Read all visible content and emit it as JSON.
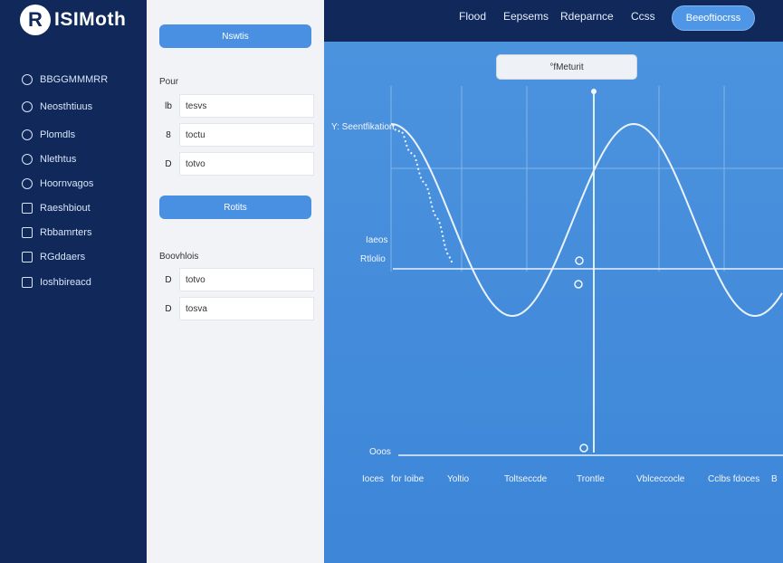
{
  "app": {
    "logo_mark": "R",
    "name": "ISIMoth"
  },
  "topnav": {
    "links": [
      "Flood",
      "Eepsems",
      "Rdeparnce",
      "Ccss"
    ],
    "action_button": "Beeoftiocrss"
  },
  "sidebar": {
    "items": [
      {
        "label": "BBGGMMMRR",
        "icon": "home-icon"
      },
      {
        "label": "Neosthtiuus",
        "icon": "settings-icon"
      },
      {
        "label": "Plomdls",
        "icon": "model-icon"
      },
      {
        "label": "Nlethtus",
        "icon": "methods-icon"
      },
      {
        "label": "Hoornvagos",
        "icon": "progress-icon"
      },
      {
        "label": "Raeshbiout",
        "icon": "document-icon"
      },
      {
        "label": "Rbbamrters",
        "icon": "parameters-icon"
      },
      {
        "label": "RGddaers",
        "icon": "grid-icon"
      },
      {
        "label": "Ioshbireacd",
        "icon": "dashboard-icon"
      }
    ]
  },
  "panel": {
    "top_button": "Nswtis",
    "section1_label": "Pour",
    "fields1": [
      {
        "key": "lb",
        "value": "tesvs"
      },
      {
        "key": "8",
        "value": "toctu"
      },
      {
        "key": "D",
        "value": "totvo"
      }
    ],
    "mid_button": "Rotits",
    "section2_label": "Boovhlois",
    "fields2": [
      {
        "key": "D",
        "value": "totvo"
      },
      {
        "key": "D",
        "value": "tosva"
      }
    ]
  },
  "plot": {
    "title": "°fMeturit",
    "curve_label": "Y: Seentfikation",
    "axis_label_1": "Iaeos",
    "axis_label_2": "Rtlolio",
    "bottom_label": "Ooos",
    "x_tick_labels": [
      "Ioces",
      "for Ioibe",
      "Yoltio",
      "Toltseccde",
      "Trontle",
      "Vblceccocle",
      "Cclbs fdoces",
      "B"
    ]
  },
  "colors": {
    "topbar": "#10295a",
    "sidebar": "#10295a",
    "plot_background": "#4a90d9",
    "accent_button": "#4a90e2"
  }
}
